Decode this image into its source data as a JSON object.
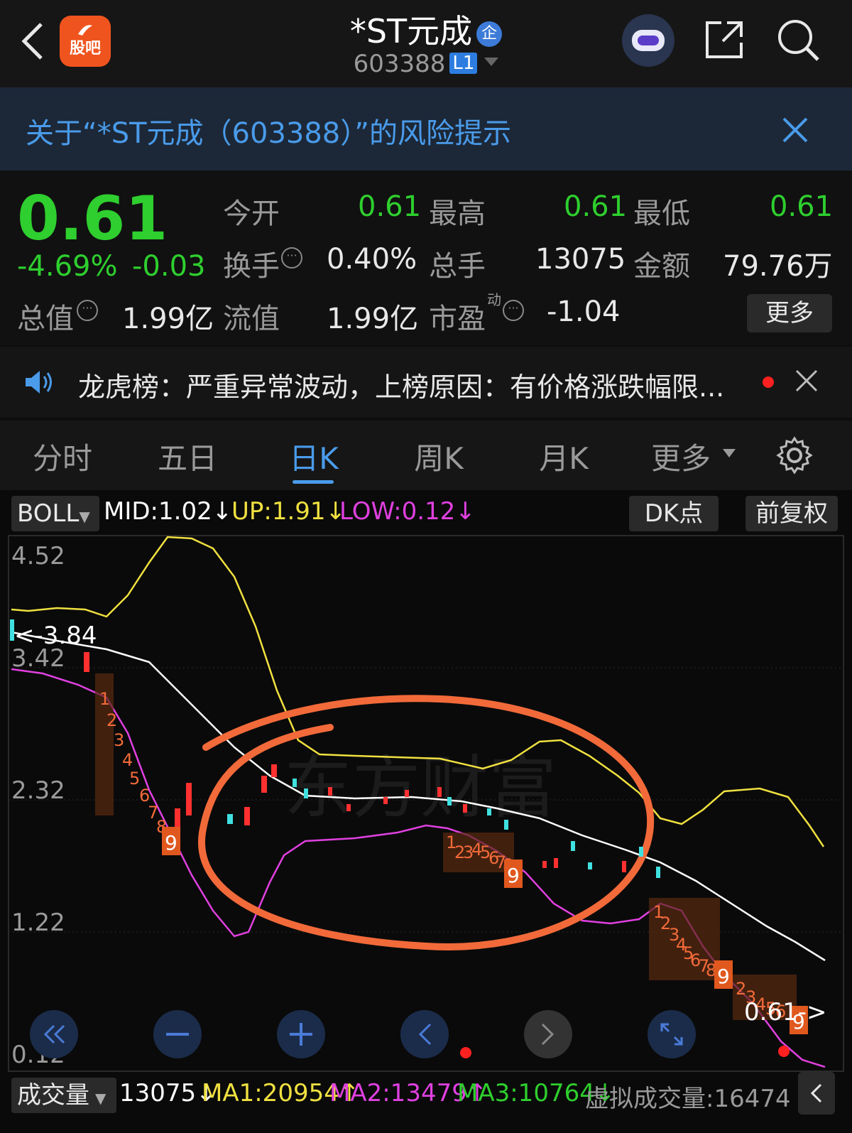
{
  "header": {
    "guba_label": "股吧",
    "stock_name": "*ST元成",
    "enterprise_badge": "企",
    "stock_code": "603388",
    "level_badge": "L1"
  },
  "risk_banner": {
    "text": "关于“*ST元成（603388）”的风险提示"
  },
  "quote": {
    "price": "0.61",
    "change_pct": "-4.69%",
    "change": "-0.03",
    "open_label": "今开",
    "open_value": "0.61",
    "high_label": "最高",
    "high_value": "0.61",
    "low_label": "最低",
    "low_value": "0.61",
    "turnover_label": "换手",
    "turnover_value": "0.40%",
    "volume_label": "总手",
    "volume_value": "13075",
    "amount_label": "金额",
    "amount_value": "79.76万",
    "mktcap_label": "总值",
    "mktcap_value": "1.99亿",
    "float_label": "流值",
    "float_value": "1.99亿",
    "pe_label": "市盈",
    "pe_sup": "动",
    "pe_value": "-1.04",
    "more_label": "更多"
  },
  "news": {
    "text": "龙虎榜：严重异常波动，上榜原因：有价格涨跌幅限..."
  },
  "tabs": [
    "分时",
    "五日",
    "日K",
    "周K",
    "月K",
    "更多"
  ],
  "active_tab": "日K",
  "indicator": {
    "name": "BOLL",
    "mid": "MID:1.02↓",
    "up": "UP:1.91↓",
    "low": "LOW:0.12↓",
    "dk_label": "DK点",
    "adjust_label": "前复权",
    "colors": {
      "mid": "#ffffff",
      "up": "#f0e040",
      "low": "#e040e0"
    }
  },
  "chart_data": {
    "type": "candlestick",
    "y_ticks": [
      "4.52",
      "3.42",
      "2.32",
      "1.22",
      "0.12"
    ],
    "ylim": [
      0.12,
      4.52
    ],
    "max_marker": "<-3.84",
    "last_marker": "0.61->",
    "sequence_labels_1": [
      "1",
      "2",
      "3",
      "4",
      "5",
      "6",
      "7",
      "8",
      "9"
    ],
    "sequence_labels_2": [
      "1",
      "2",
      "3",
      "4",
      "5",
      "6",
      "7",
      "8",
      "9"
    ],
    "sequence_labels_3": [
      "1",
      "2",
      "3",
      "4",
      "5",
      "6",
      "7",
      "8",
      "9"
    ],
    "sequence_labels_4": [
      "2",
      "3",
      "4",
      "5",
      "6",
      "9"
    ],
    "watermark": "东方财富"
  },
  "volume": {
    "label": "成交量",
    "value": "13075↓",
    "ma1": "MA1:20954↑",
    "ma2": "MA2:13479↑",
    "ma3": "MA3:10764↓",
    "virtual": "虚拟成交量:16474",
    "colors": {
      "ma1": "#f0e040",
      "ma2": "#e040e0",
      "ma3": "#2ecf2e"
    }
  }
}
